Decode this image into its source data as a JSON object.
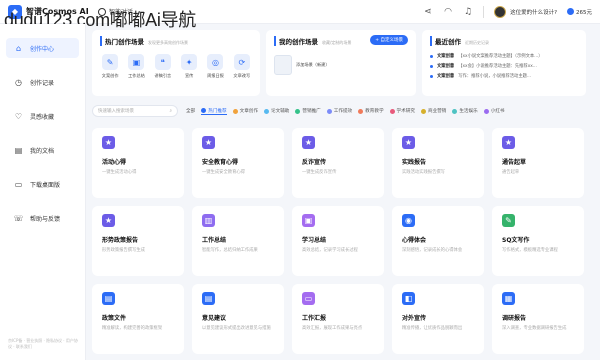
{
  "watermark": "dudu123.com嘟嘟Ai导航",
  "topbar": {
    "logo_text": "智谱Cosmos AI",
    "mode_label": "智能对话",
    "user_name": "这位爱的什么设计?",
    "points": "265元"
  },
  "sidebar": {
    "items": [
      {
        "label": "创作中心",
        "icon": "⌂"
      },
      {
        "label": "创作记录",
        "icon": "◷"
      },
      {
        "label": "灵感收藏",
        "icon": "♡"
      },
      {
        "label": "我的文档",
        "icon": "▤"
      },
      {
        "label": "下载桌面版",
        "icon": "▭"
      },
      {
        "label": "帮助与反馈",
        "icon": "☏"
      }
    ],
    "footer": "京ICP备 · 营业执照 · 隐私协议 · 用户协议 · 联系我们"
  },
  "hot": {
    "title": "热门创作场景",
    "subtitle": "发现更多高效创作场景",
    "items": [
      {
        "label": "文案创作",
        "icon": "✎"
      },
      {
        "label": "工作总结",
        "icon": "▣"
      },
      {
        "label": "讲稿引言",
        "icon": "❝"
      },
      {
        "label": "宣传",
        "icon": "✦"
      },
      {
        "label": "周报日报",
        "icon": "◎"
      },
      {
        "label": "文章改写",
        "icon": "⟳"
      }
    ]
  },
  "mine": {
    "title": "我的创作场景",
    "subtitle": "收藏/定制的场景",
    "new_button": "+ 自定义场景",
    "item_label": "添加场景（新建）"
  },
  "recent": {
    "title": "最近创作",
    "subtitle": "近期历史记录",
    "items": [
      {
        "key": "文案创意",
        "text": "【xx小说文案推荐活动主题】（示例文本...）"
      },
      {
        "key": "文案创意",
        "text": "【xx会】小说推荐活动主题：先推荐xx..."
      },
      {
        "key": "文案创意",
        "text": "写作：推荐小说，小说推荐活动主题..."
      }
    ]
  },
  "filter": {
    "search_placeholder": "快速输入搜索场景",
    "categories": [
      {
        "label": "全部",
        "color": ""
      },
      {
        "label": "热门推荐",
        "color": "#2c6cf6"
      },
      {
        "label": "文章创作",
        "color": "#f0a23c"
      },
      {
        "label": "论文辅助",
        "color": "#57b9f0"
      },
      {
        "label": "营销推广",
        "color": "#35c28a"
      },
      {
        "label": "工作提效",
        "color": "#7c8cf8"
      },
      {
        "label": "教育教学",
        "color": "#f07a5a"
      },
      {
        "label": "学术研究",
        "color": "#e85a7c"
      },
      {
        "label": "商业营销",
        "color": "#d6b02c"
      },
      {
        "label": "生活娱乐",
        "color": "#4fc3c3"
      },
      {
        "label": "小红书",
        "color": "#9b6cf0"
      }
    ]
  },
  "cards": [
    {
      "title": "活动心得",
      "desc": "一键生成活动心得",
      "color": "#6c5ce7",
      "icon": "★"
    },
    {
      "title": "安全教育心得",
      "desc": "一键生成安全教育心得",
      "color": "#6c5ce7",
      "icon": "★"
    },
    {
      "title": "反诈宣传",
      "desc": "一键生成反诈宣传",
      "color": "#6c5ce7",
      "icon": "★"
    },
    {
      "title": "实践报告",
      "desc": "实践活动实践报告撰写",
      "color": "#6c5ce7",
      "icon": "★"
    },
    {
      "title": "通告起草",
      "desc": "通告起草",
      "color": "#6c5ce7",
      "icon": "★"
    },
    {
      "title": "形势政策报告",
      "desc": "形势政策报告撰写生成",
      "color": "#6c5ce7",
      "icon": "★"
    },
    {
      "title": "工作总结",
      "desc": "智能写作，总结归纳工作成果",
      "color": "#8e6cf0",
      "icon": "▥"
    },
    {
      "title": "学习总结",
      "desc": "高效总结，记录学习成长过程",
      "color": "#a46cf0",
      "icon": "▣"
    },
    {
      "title": "心得体会",
      "desc": "深刻感悟，记录成长的心得体会",
      "color": "#2c6cf6",
      "icon": "◉"
    },
    {
      "title": "SQ文写作",
      "desc": "写作格式，模板精选专业课程",
      "color": "#35b36b",
      "icon": "✎"
    },
    {
      "title": "政策文件",
      "desc": "精准解读，构建完善的政策框架",
      "color": "#2c6cf6",
      "icon": "▤"
    },
    {
      "title": "意见建议",
      "desc": "以意见建议形式提出改进意见与措施",
      "color": "#2c6cf6",
      "icon": "▤"
    },
    {
      "title": "工作汇报",
      "desc": "高效汇报，展现工作成果与亮点",
      "color": "#a46cf0",
      "icon": "▭"
    },
    {
      "title": "对外宣传",
      "desc": "精准传播，让优质作品脱颖而出",
      "color": "#2c6cf6",
      "icon": "◧"
    },
    {
      "title": "调研报告",
      "desc": "深入调查，专业数据调研报告生成",
      "color": "#2c6cf6",
      "icon": "▦"
    }
  ]
}
